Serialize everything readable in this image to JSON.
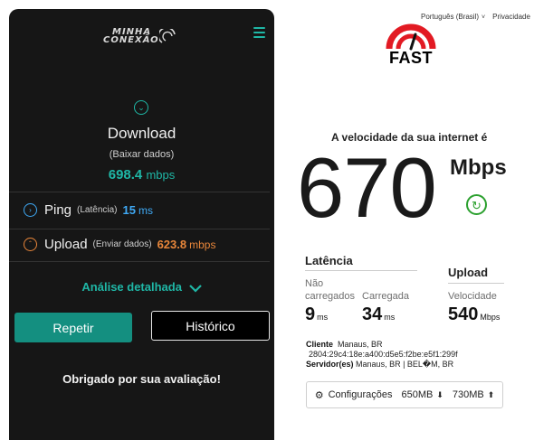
{
  "minha_conexao": {
    "logo_line1": "MINHA",
    "logo_line2": "CONEXÃO",
    "download": {
      "title": "Download",
      "subtitle": "(Baixar dados)",
      "value": "698.4",
      "unit": "mbps"
    },
    "ping": {
      "label": "Ping",
      "subtitle": "(Latência)",
      "value": "15",
      "unit": "ms"
    },
    "upload": {
      "label": "Upload",
      "subtitle": "(Enviar dados)",
      "value": "623.8",
      "unit": "mbps"
    },
    "analise": "Análise detalhada",
    "repetir_label": "Repetir",
    "historico_label": "Histórico",
    "thanks": "Obrigado por sua avaliação!",
    "accent_color": "#1fb7a6",
    "upload_color": "#e8863a"
  },
  "fast": {
    "language": "Português (Brasil)",
    "privacy": "Privacidade",
    "logo_text": "FAST",
    "headline": "A velocidade da sua internet é",
    "speed": "670",
    "speed_unit": "Mbps",
    "latency": {
      "title": "Latência",
      "unloaded_label_1": "Não",
      "unloaded_label_2": "carregados",
      "unloaded_value": "9",
      "loaded_label": "Carregada",
      "loaded_value": "34",
      "unit": "ms"
    },
    "upload": {
      "title": "Upload",
      "label": "Velocidade",
      "value": "540",
      "unit": "Mbps"
    },
    "client": {
      "client_label": "Cliente",
      "client_location": "Manaus, BR",
      "client_ip": "2804:29c4:18e:a400:d5e5:f2be:e5f1:299f",
      "server_label": "Servidor(es)",
      "server_value": "Manaus, BR  |  BEL�M, BR"
    },
    "settings": {
      "label": "Configurações",
      "download_size": "650MB",
      "upload_size": "730MB"
    },
    "brand_color": "#e21a23"
  }
}
